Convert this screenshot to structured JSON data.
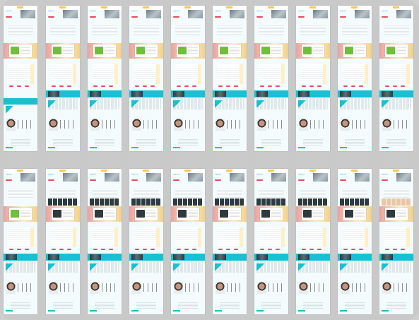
{
  "grid": {
    "rows": [
      {
        "variant_labels": [
          "page-1",
          "page-2",
          "page-3",
          "page-4",
          "page-5",
          "page-6",
          "page-7",
          "page-8",
          "page-9",
          "page-10"
        ],
        "pages": [
          {
            "hero_title": "Page title",
            "cta": "CTA",
            "variant": "teal-band-lower"
          },
          {
            "hero_title": "Page title",
            "cta": "CTA",
            "variant": "default"
          },
          {
            "hero_title": "Page title",
            "cta": "CTA",
            "variant": "default"
          },
          {
            "hero_title": "Page title",
            "cta": "CTA",
            "variant": "default"
          },
          {
            "hero_title": "Page title",
            "cta": "CTA",
            "variant": "default"
          },
          {
            "hero_title": "Page title",
            "cta": "CTA",
            "variant": "default"
          },
          {
            "hero_title": "Page title",
            "cta": "CTA",
            "variant": "default"
          },
          {
            "hero_title": "Page title",
            "cta": "CTA",
            "variant": "default"
          },
          {
            "hero_title": "Page title",
            "cta": "CTA",
            "variant": "default"
          },
          {
            "hero_title": "Page title",
            "cta": "CTA",
            "variant": "default"
          }
        ]
      },
      {
        "pages": [
          {
            "hero_title": "Page title",
            "cta": "CTA",
            "variant": "default"
          },
          {
            "hero_title": "Page title",
            "cta": "CTA",
            "variant": "dark-grid"
          },
          {
            "hero_title": "Page title",
            "cta": "CTA",
            "variant": "dark-grid"
          },
          {
            "hero_title": "Page title",
            "cta": "CTA",
            "variant": "dark-grid"
          },
          {
            "hero_title": "Page title",
            "cta": "CTA",
            "variant": "dark-grid"
          },
          {
            "hero_title": "Page title",
            "cta": "CTA",
            "variant": "dark-grid"
          },
          {
            "hero_title": "Page title",
            "cta": "CTA",
            "variant": "dark-grid"
          },
          {
            "hero_title": "Page title",
            "cta": "CTA",
            "variant": "dark-grid"
          },
          {
            "hero_title": "Page title",
            "cta": "CTA",
            "variant": "dark-grid"
          },
          {
            "hero_title": "Page title",
            "cta": "CTA",
            "variant": "light-grid"
          }
        ]
      }
    ]
  },
  "colors": {
    "accent": "#17c0d2",
    "cta": "#e84c5b",
    "highlight": "#f6c94a",
    "page_bg": "#f4fbfc",
    "canvas_bg": "#c9c9c9"
  },
  "icons": [
    "logo-icon",
    "product-image",
    "avatar-photo",
    "social-icon"
  ]
}
